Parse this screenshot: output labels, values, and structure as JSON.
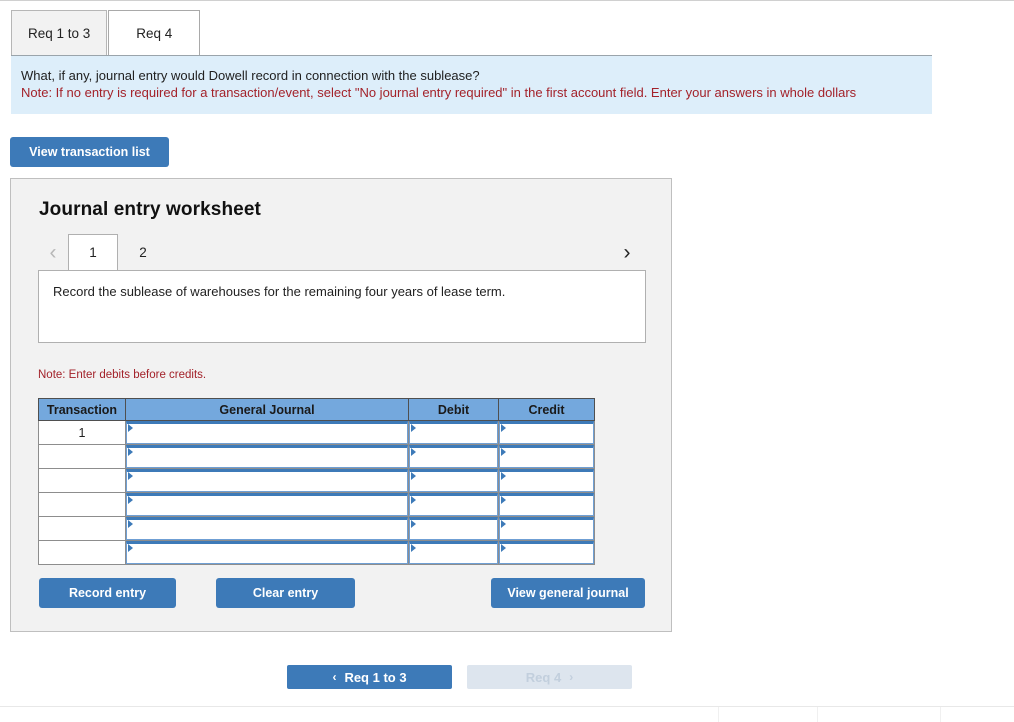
{
  "req_tabs": [
    {
      "label": "Req 1 to 3",
      "active": false
    },
    {
      "label": "Req 4",
      "active": true
    }
  ],
  "instructions": {
    "question": "What, if any, journal entry would Dowell record in connection with the sublease?",
    "note": "Note: If no entry is required for a transaction/event, select \"No journal entry required\" in the first account field. Enter your answers in whole dollars"
  },
  "toolbar": {
    "view_transaction_list_label": "View transaction list"
  },
  "worksheet": {
    "title": "Journal entry worksheet",
    "prev_arrow": "‹",
    "next_arrow": "›",
    "entry_tabs": [
      {
        "label": "1",
        "active": true
      },
      {
        "label": "2",
        "active": false
      }
    ],
    "description": "Record the sublease of warehouses for the remaining four years of lease term.",
    "note_debits": "Note: Enter debits before credits.",
    "table": {
      "headers": [
        "Transaction",
        "General Journal",
        "Debit",
        "Credit"
      ],
      "rows": [
        {
          "transaction": "1",
          "general_journal": "",
          "debit": "",
          "credit": ""
        },
        {
          "transaction": "",
          "general_journal": "",
          "debit": "",
          "credit": ""
        },
        {
          "transaction": "",
          "general_journal": "",
          "debit": "",
          "credit": ""
        },
        {
          "transaction": "",
          "general_journal": "",
          "debit": "",
          "credit": ""
        },
        {
          "transaction": "",
          "general_journal": "",
          "debit": "",
          "credit": ""
        },
        {
          "transaction": "",
          "general_journal": "",
          "debit": "",
          "credit": ""
        }
      ]
    },
    "actions": {
      "record_entry_label": "Record entry",
      "clear_entry_label": "Clear entry",
      "view_general_journal_label": "View general journal"
    }
  },
  "pager": {
    "prev": {
      "label": "Req 1 to 3",
      "chevron": "‹",
      "enabled": true
    },
    "next": {
      "label": "Req 4",
      "chevron": "›",
      "enabled": false
    }
  },
  "colors": {
    "accent_blue": "#3d7ab8",
    "table_header_blue": "#74a8dd",
    "banner_blue": "#ddeefa",
    "note_red": "#a3222a",
    "panel_gray": "#f2f2f2"
  }
}
